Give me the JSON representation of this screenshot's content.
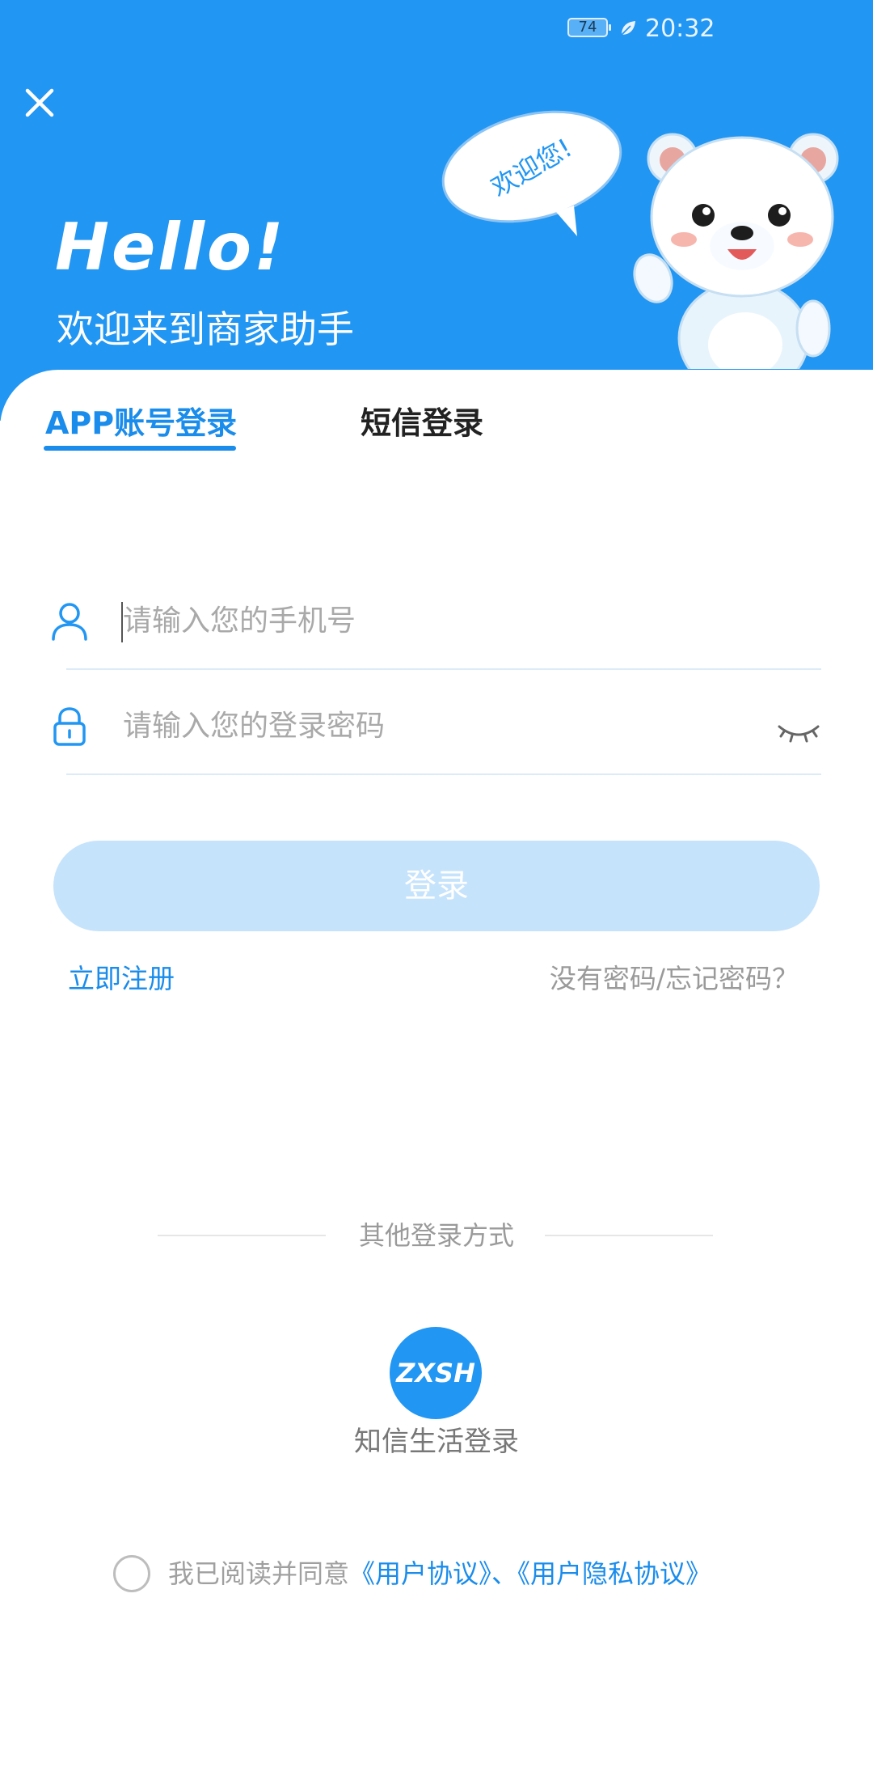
{
  "status_bar": {
    "battery": "74",
    "time": "20:32"
  },
  "header": {
    "greeting": "Hello!",
    "subtitle": "欢迎来到商家助手",
    "bubble_text": "欢迎您!"
  },
  "tabs": [
    {
      "label": "APP账号登录",
      "active": true
    },
    {
      "label": "短信登录",
      "active": false
    }
  ],
  "form": {
    "phone_placeholder": "请输入您的手机号",
    "password_placeholder": "请输入您的登录密码"
  },
  "actions": {
    "login": "登录",
    "register": "立即注册",
    "forgot": "没有密码/忘记密码？"
  },
  "other_login": {
    "label": "其他登录方式",
    "provider_badge": "ZXSH",
    "provider_label": "知信生活登录"
  },
  "agreement": {
    "prefix": "我已阅读并同意",
    "user_agreement": "《用户协议》",
    "separator": "、",
    "privacy_agreement": "《用户隐私协议》"
  },
  "colors": {
    "primary": "#2196f3",
    "link": "#1a8ceb",
    "button_disabled": "#c6e3fc"
  }
}
